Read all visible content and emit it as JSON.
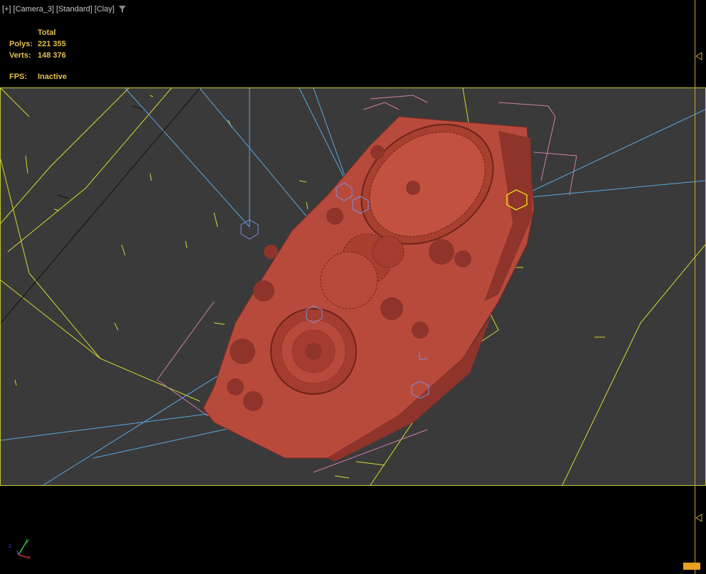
{
  "viewport": {
    "menu_label": "[+]",
    "camera_label": "[Camera_3]",
    "shading_label": "[Standard]",
    "style_label": "[Clay]",
    "filter_icon": "filter-icon"
  },
  "stats": {
    "header": "Total",
    "polys_label": "Polys:",
    "polys_value": "221 355",
    "verts_label": "Verts:",
    "verts_value": "148 376",
    "fps_label": "FPS:",
    "fps_value": "Inactive"
  },
  "colors": {
    "model": "#b84a3c",
    "helper_yellow": "#d8d830",
    "light_blue": "#5aa8e0",
    "frustum_pink": "#d080a8",
    "viewport_bg": "#3a3a3a",
    "stats_text": "#e5c04a"
  },
  "gizmo": {
    "x": "x",
    "y": "y",
    "z": "z"
  }
}
